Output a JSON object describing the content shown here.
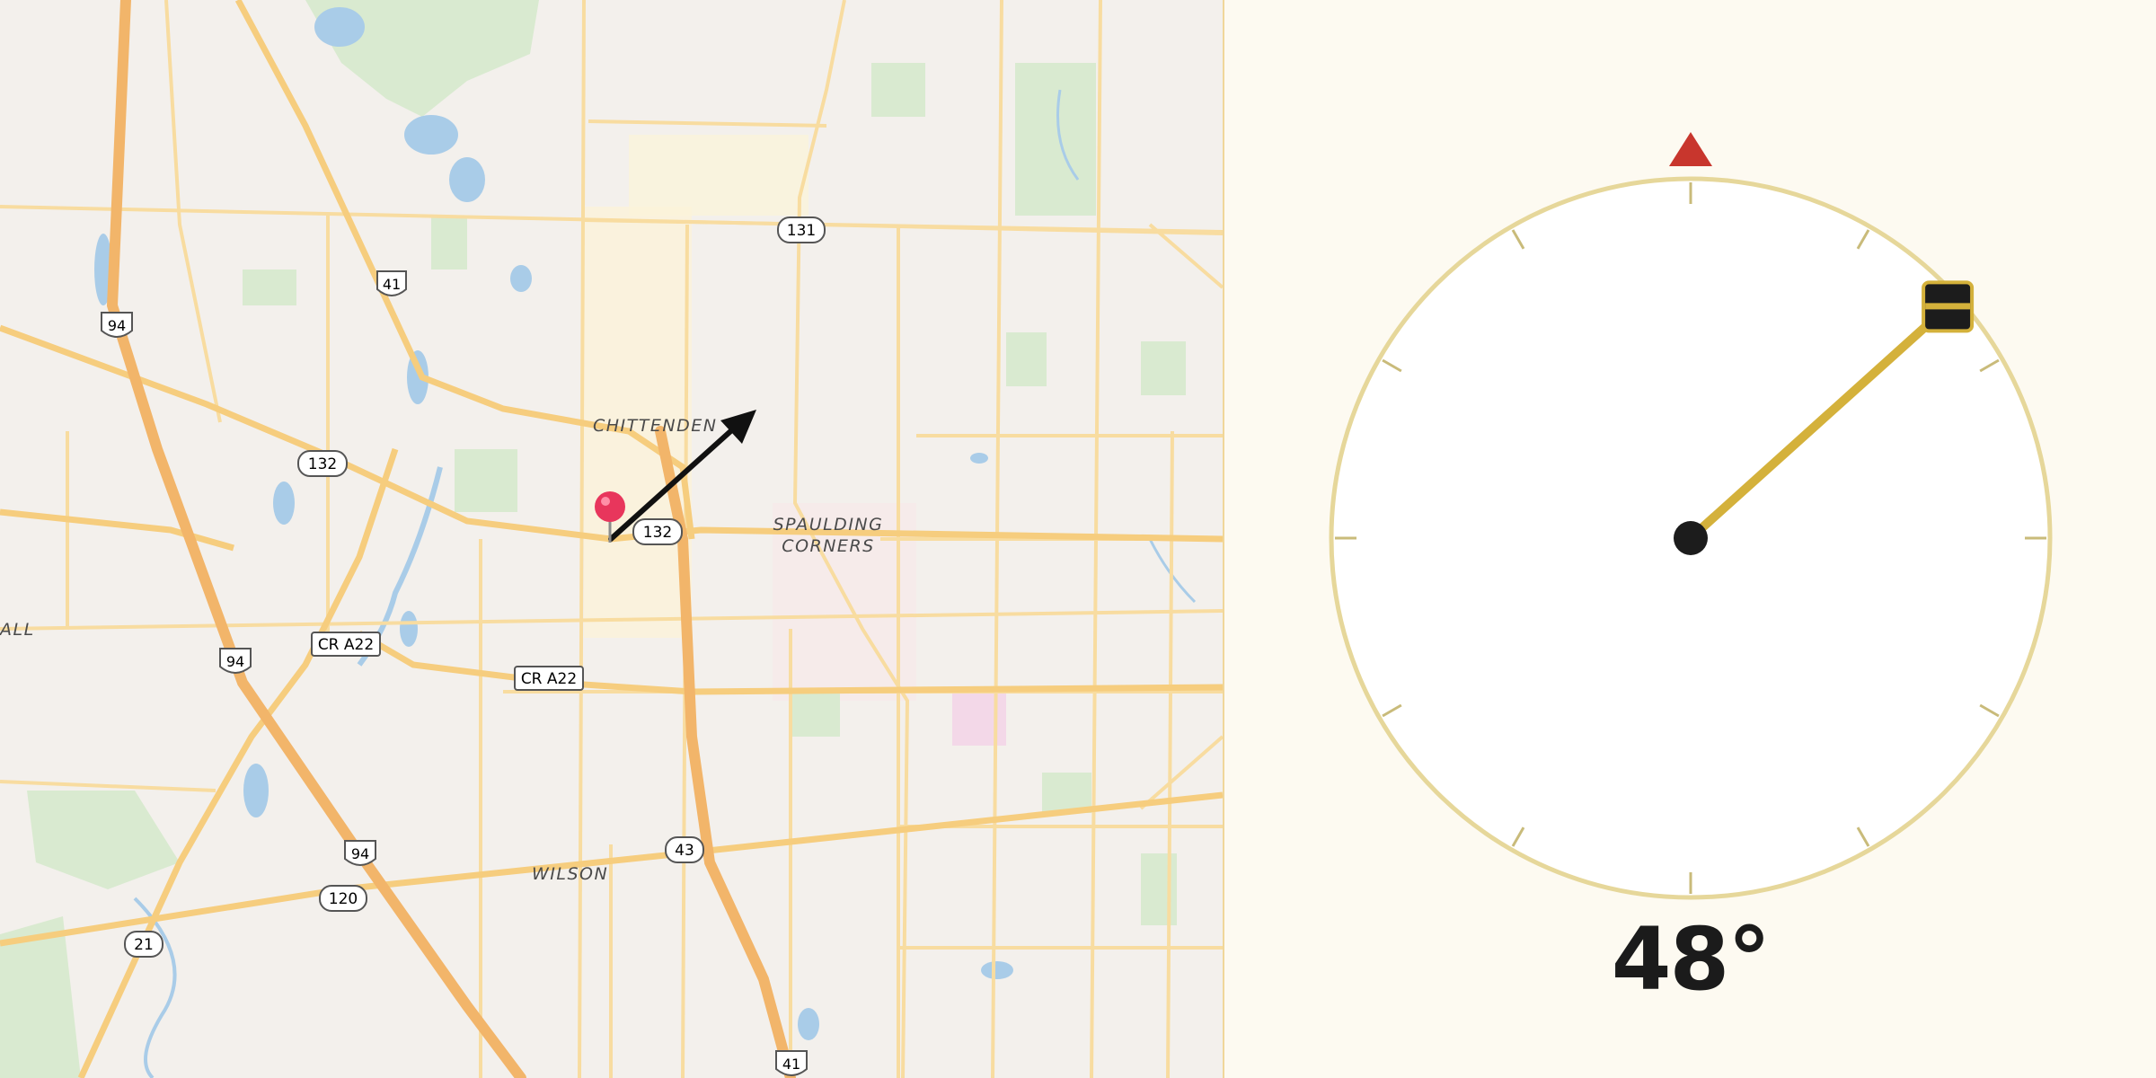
{
  "map": {
    "shields": {
      "s131": "131",
      "s41a": "41",
      "s94a": "94",
      "s132a": "132",
      "s132b": "132",
      "scra22a": "CR A22",
      "scra22b": "CR A22",
      "s94b": "94",
      "s94c": "94",
      "s43": "43",
      "s120": "120",
      "s21": "21",
      "s41b": "41"
    },
    "places": {
      "chittenden": "CHITTENDEN",
      "spaulding_1": "SPAULDING",
      "spaulding_2": "CORNERS",
      "wilson": "WILSON",
      "edge_all": "ALL"
    },
    "pin_icon": "map-pin-icon",
    "arrow_icon": "direction-arrow-icon"
  },
  "compass": {
    "heading_deg": 48,
    "heading_label": "48°",
    "north_marker_icon": "north-triangle-icon",
    "needle_color": "#d4b13b",
    "north_color": "#c8362d"
  }
}
